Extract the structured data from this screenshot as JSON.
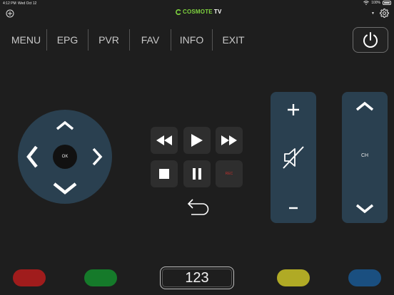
{
  "status_bar": {
    "time": "4:12 PM",
    "date": "Wed Oct 12",
    "battery": "100%"
  },
  "header": {
    "add_icon": "plus-circle-icon",
    "logo_brand": "COSMOTE",
    "logo_tv": "TV",
    "settings_icon": "gear-icon"
  },
  "menu": {
    "items": [
      "MENU",
      "EPG",
      "PVR",
      "FAV",
      "INFO",
      "EXIT"
    ]
  },
  "dpad": {
    "ok_label": "OK"
  },
  "transport": {
    "rec_label": "REC"
  },
  "channel": {
    "label": "CH"
  },
  "numpad": {
    "label": "123"
  },
  "colors": {
    "background": "#1e1e1e",
    "panel": "#2a4050",
    "red_key": "#a01c1c",
    "green_key": "#157a2a",
    "yellow_key": "#b0aa25",
    "blue_key": "#1a4f80",
    "rec_text": "#c0302c",
    "brand_green": "#7fd43f"
  }
}
